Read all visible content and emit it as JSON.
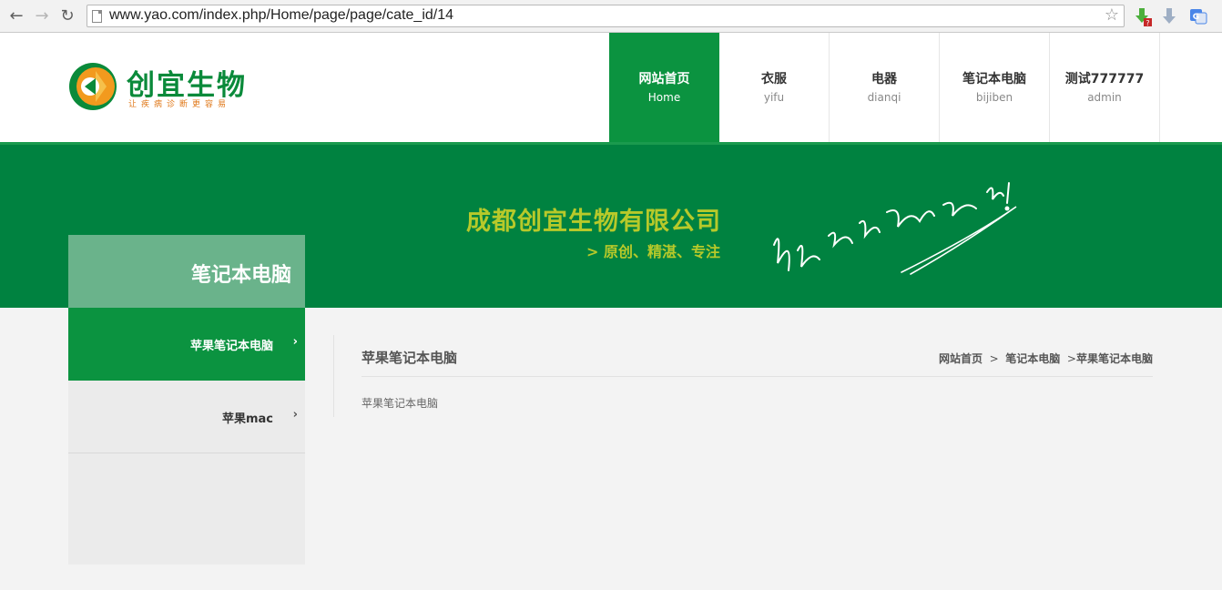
{
  "browser": {
    "url": "www.yao.com/index.php/Home/page/page/cate_id/14",
    "back_icon": "back-arrow-icon",
    "forward_icon": "forward-arrow-icon",
    "reload_icon": "reload-icon",
    "bookmark_icon": "star-icon"
  },
  "header": {
    "brand": "创宜生物",
    "slogan": "让疾病诊断更容易",
    "nav": [
      {
        "zh": "网站首页",
        "en": "Home",
        "active": true
      },
      {
        "zh": "衣服",
        "en": "yifu",
        "active": false
      },
      {
        "zh": "电器",
        "en": "dianqi",
        "active": false
      },
      {
        "zh": "笔记本电脑",
        "en": "bijiben",
        "active": false
      },
      {
        "zh": "测试777777",
        "en": "admin",
        "active": false
      }
    ]
  },
  "banner": {
    "company": "成都创宜生物有限公司",
    "motto": "> 原创、精湛、专注",
    "script_text": "让疾病诊断更容易!"
  },
  "sidebar": {
    "title": "笔记本电脑",
    "items": [
      {
        "label": "苹果笔记本电脑",
        "active": true
      },
      {
        "label": "苹果mac",
        "active": false
      }
    ]
  },
  "content": {
    "title": "苹果笔记本电脑",
    "breadcrumb": [
      "网站首页",
      "笔记本电脑",
      "苹果笔记本电脑"
    ],
    "body": "苹果笔记本电脑"
  },
  "colors": {
    "brand_green": "#0b9340",
    "banner_green": "#008240",
    "sidebar_title": "#6ab38b",
    "accent_yellow": "#b7c92a"
  }
}
